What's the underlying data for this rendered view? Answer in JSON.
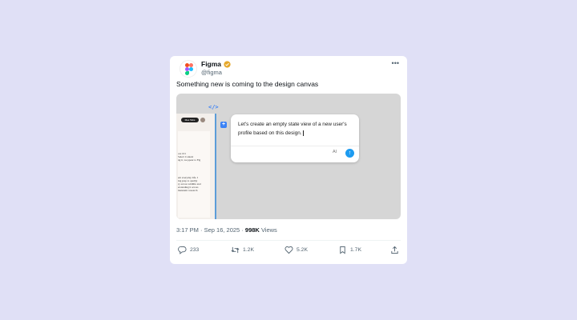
{
  "post": {
    "author": {
      "name": "Figma",
      "handle": "@figma",
      "verified_color": "#e6a82b"
    },
    "more_icon": "more-horizontal-icon",
    "text": "Something new is coming to the design canvas",
    "media": {
      "code_icon": "</>",
      "mock_pill": "Mes Tabs",
      "mock_text": [
        "ore 101",
        "Select Context",
        "ng it, we ppear to Fig",
        "",
        "",
        "ent everyday life. I",
        "ing prep to quality",
        "ry across wildlife and",
        "erstanding it across",
        "menstetic research"
      ],
      "prompt_text": "Let's create an empty state view of a new user's profile based on this design.",
      "ai_label": "AI",
      "send_icon": "arrow-up-icon",
      "plus_icon": "plus-icon"
    },
    "meta": {
      "time": "3:17 PM",
      "date": "Sep 16, 2025",
      "views_count": "998K",
      "views_label": "Views"
    },
    "actions": {
      "reply": {
        "icon": "reply-icon",
        "count": "233"
      },
      "repost": {
        "icon": "repost-icon",
        "count": "1.2K"
      },
      "like": {
        "icon": "heart-icon",
        "count": "5.2K"
      },
      "bookmark": {
        "icon": "bookmark-icon",
        "count": "1.7K"
      },
      "share": {
        "icon": "share-icon"
      }
    }
  }
}
